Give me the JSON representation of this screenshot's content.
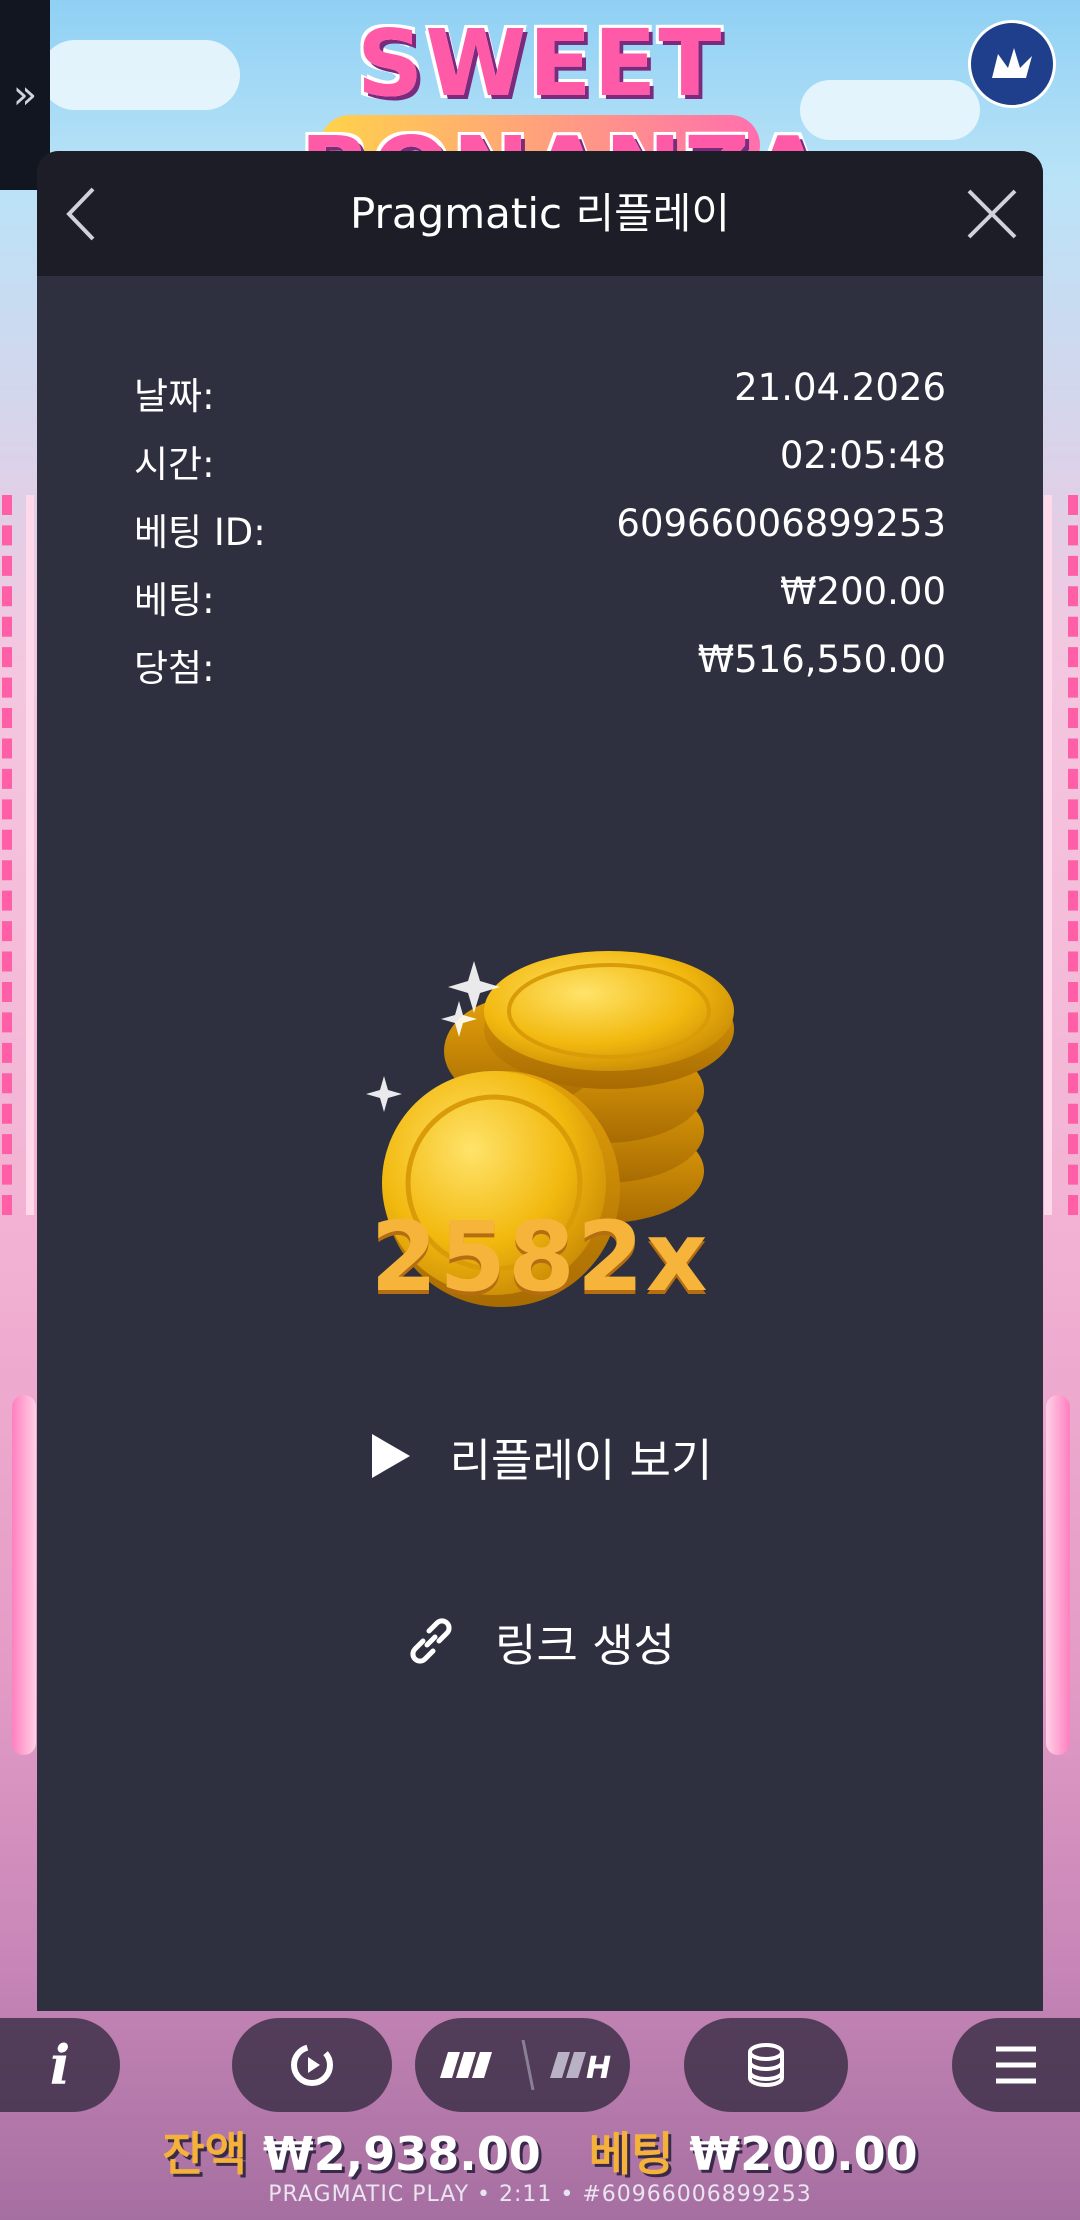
{
  "game": {
    "logo_text": "SWEET BONANZA",
    "side_tab_icon": "double-chevron-right-icon",
    "badge_icon": "crown-icon"
  },
  "modal": {
    "title": "Pragmatic 리플레이",
    "back_icon": "chevron-left-icon",
    "close_icon": "close-icon",
    "details": [
      {
        "label": "날짜:",
        "value": "21.04.2026"
      },
      {
        "label": "시간:",
        "value": "02:05:48"
      },
      {
        "label": "베팅 ID:",
        "value": "60966006899253"
      },
      {
        "label": "베팅:",
        "value": "₩200.00"
      },
      {
        "label": "당첨:",
        "value": "₩516,550.00"
      }
    ],
    "multiplier": "2582x",
    "watch_replay": "리플레이 보기",
    "create_link": "링크 생성"
  },
  "bottom": {
    "balance_label": "잔액",
    "balance_value": "₩2,938.00",
    "bet_label": "베팅",
    "bet_value": "₩200.00",
    "footer": "PRAGMATIC PLAY • 2:11 • #60966006899253",
    "buttons": [
      "info-icon",
      "autoplay-icon",
      "turbo-icon",
      "coins-icon",
      "menu-icon"
    ]
  },
  "colors": {
    "modal_bg": "#2e3040",
    "header_bg": "#1c1d26",
    "gold": "#f6b53a"
  }
}
